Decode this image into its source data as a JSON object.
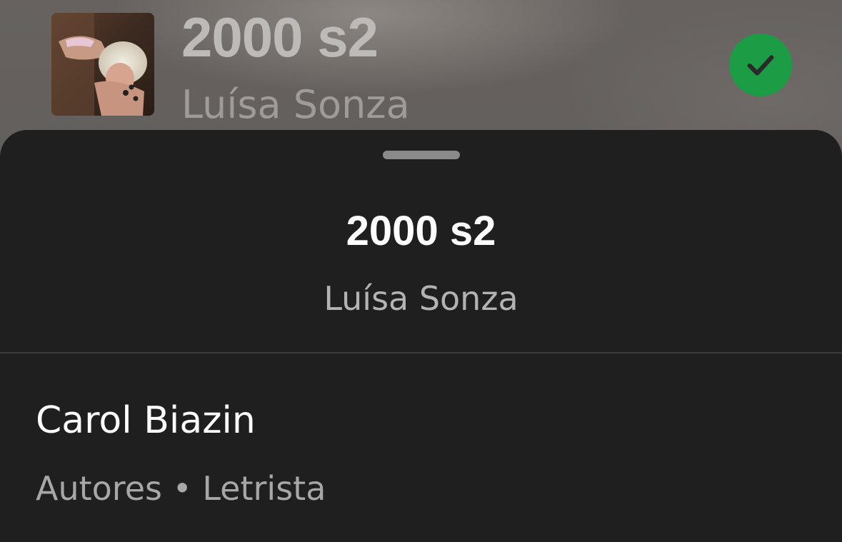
{
  "now_playing": {
    "title": "2000 s2",
    "artist": "Luísa Sonza",
    "liked_icon": "check-circle-icon",
    "liked_color": "#1b9c45"
  },
  "sheet": {
    "title": "2000 s2",
    "artist": "Luísa Sonza",
    "credits": [
      {
        "name": "Carol Biazin",
        "roles": "Autores • Letrista"
      }
    ]
  },
  "colors": {
    "sheet_background": "#1f1f1f",
    "accent_green": "#1b9c45"
  }
}
